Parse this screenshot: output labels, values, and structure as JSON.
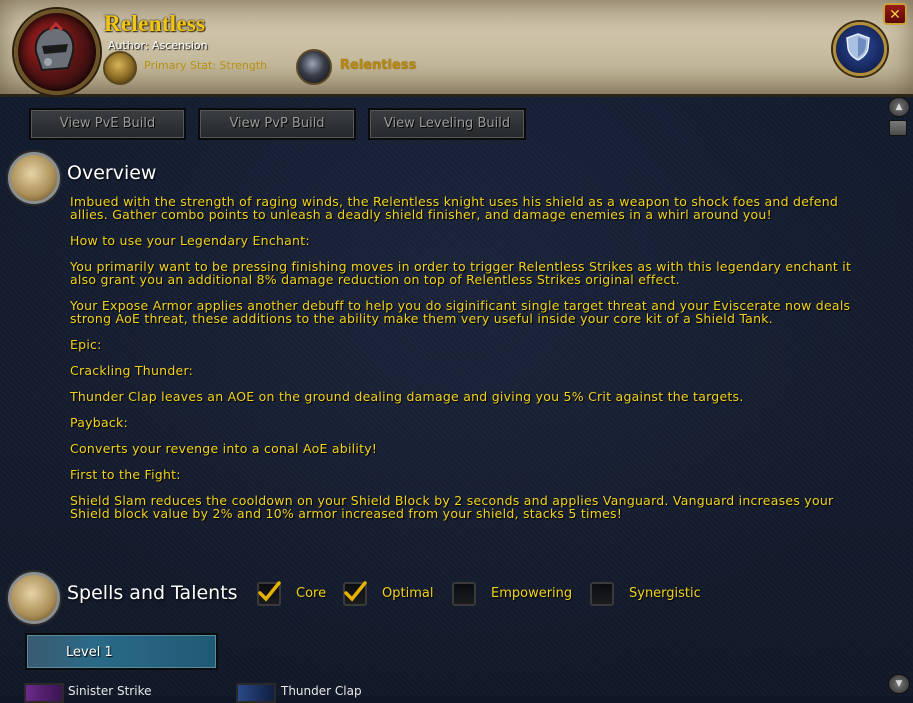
{
  "header": {
    "title": "Relentless",
    "author": "Author: Ascension",
    "primary_stat": "Primary Stat: Strength",
    "spec_name": "Relentless",
    "close_label": "✕"
  },
  "build_buttons": [
    "View PvE Build",
    "View PvP Build",
    "View Leveling Build"
  ],
  "overview": {
    "title": "Overview",
    "paragraphs": [
      "Imbued with the strength of raging winds, the Relentless knight uses his shield as a weapon to shock foes and defend allies. Gather combo points to unleash a deadly shield finisher, and damage enemies in a whirl around you!",
      "How to use your Legendary Enchant:",
      "You primarily want to be pressing finishing moves in order to trigger Relentless Strikes as with this legendary enchant it also grant you an additional 8% damage reduction on top of Relentless Strikes original effect.",
      "Your Expose Armor applies another debuff to help you do siginificant single target threat and your Eviscerate now deals strong AoE threat, these additions to the ability make them very useful inside your core kit of a Shield Tank.",
      "Epic:",
      "Crackling Thunder:",
      "Thunder Clap leaves an AOE on the ground dealing damage and giving you 5% Crit against the targets.",
      "Payback:",
      "Converts your revenge into a conal AoE ability!",
      "First to the Fight:",
      "Shield Slam reduces the cooldown on your Shield Block by 2 seconds and applies Vanguard. Vanguard increases your Shield block value by 2% and 10% armor increased from your shield, stacks 5 times!"
    ]
  },
  "spells": {
    "title": "Spells and Talents",
    "filters": [
      {
        "label": "Core",
        "checked": true
      },
      {
        "label": "Optimal",
        "checked": true
      },
      {
        "label": "Empowering",
        "checked": false
      },
      {
        "label": "Synergistic",
        "checked": false
      }
    ],
    "level_label": "Level 1",
    "items": [
      "Sinister Strike",
      "Thunder Clap"
    ]
  },
  "colors": {
    "title_gold": "#f3c613",
    "body_text": "#f1d21c",
    "panel_bg": "#121b2e",
    "parchment": "#cfc4a9"
  },
  "icons": {
    "portrait": "red-armored-helm-icon",
    "primary_stat": "strength-figure-icon",
    "spec": "dark-orb-icon",
    "shield": "shield-icon",
    "overview": "scroll-icon",
    "spells": "spellbook-icon"
  }
}
